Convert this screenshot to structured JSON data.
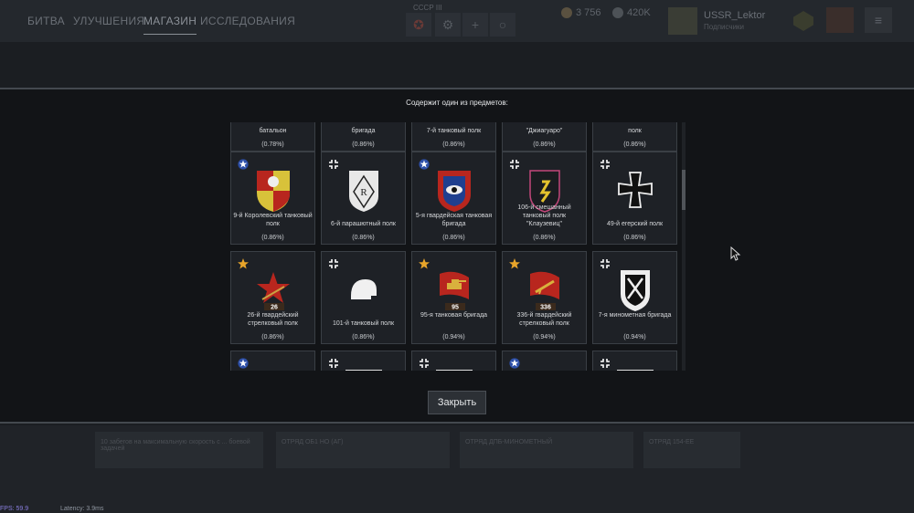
{
  "nav": {
    "tabs": [
      "БИТВА",
      "УЛУЧШЕНИЯ",
      "МАГАЗИН",
      "ИССЛЕДОВАНИЯ"
    ],
    "active_tab": "МАГАЗИН"
  },
  "header": {
    "nation_label": "СССР III",
    "gold": "3 756",
    "silver": "420K",
    "player_name": "USSR_Lektor",
    "player_status": "Подписчики"
  },
  "bottom": {
    "tasks": [
      "10 забегов на максимальную скорость с ... боевой задачей",
      "ОТРЯД ОБ1 НО (АГ)",
      "ОТРЯД ДПБ-МИНОМЕТНЫЙ",
      "ОТРЯД 154-ЕЕ"
    ],
    "fps": "FPS: 59.9",
    "latency": "Latency: 3.9ms"
  },
  "dialog": {
    "title": "Содержит один из предметов:",
    "close_label": "Закрыть"
  },
  "items": [
    {
      "name": "батальон",
      "chance": "(0.78%)",
      "mark": "usa",
      "emblem": "none"
    },
    {
      "name": "бригада",
      "chance": "(0.86%)",
      "mark": "ger",
      "emblem": "none"
    },
    {
      "name": "7-й танковый полк",
      "chance": "(0.86%)",
      "mark": "ger",
      "emblem": "none"
    },
    {
      "name": "\"Джиагуаро\"",
      "chance": "(0.86%)",
      "mark": "ger",
      "emblem": "none"
    },
    {
      "name": "полк",
      "chance": "(0.86%)",
      "mark": "ger",
      "emblem": "none"
    },
    {
      "name": "9-й Королевский танковый полк",
      "chance": "(0.86%)",
      "mark": "usa",
      "emblem": "shield-royal"
    },
    {
      "name": "6-й парашютный полк",
      "chance": "(0.86%)",
      "mark": "ger",
      "emblem": "shield-r"
    },
    {
      "name": "5-я гвардейская танковая бригада",
      "chance": "(0.86%)",
      "mark": "usa",
      "emblem": "shield-eye"
    },
    {
      "name": "106-й смешанный танковый полк \"Клаузевиц\"",
      "chance": "(0.86%)",
      "mark": "ger",
      "emblem": "shield-rune"
    },
    {
      "name": "49-й егерский полк",
      "chance": "(0.86%)",
      "mark": "ger",
      "emblem": "iron-cross"
    },
    {
      "name": "26-й гвардейский стрелковый полк",
      "chance": "(0.86%)",
      "mark": "ussr",
      "emblem": "red-star",
      "badge": "26"
    },
    {
      "name": "101-й танковый полк",
      "chance": "(0.86%)",
      "mark": "ger",
      "emblem": "helmet"
    },
    {
      "name": "95-я танковая бригада",
      "chance": "(0.94%)",
      "mark": "ussr",
      "emblem": "red-flag-tank",
      "badge": "95"
    },
    {
      "name": "336-й гвардейский стрелковый полк",
      "chance": "(0.94%)",
      "mark": "ussr",
      "emblem": "red-flag-gun",
      "badge": "336"
    },
    {
      "name": "7-я минометная бригада",
      "chance": "(0.94%)",
      "mark": "ger",
      "emblem": "shield-x"
    },
    {
      "name": "",
      "chance": "",
      "mark": "usa",
      "emblem": "partial"
    },
    {
      "name": "",
      "chance": "",
      "mark": "ger",
      "emblem": "partial"
    },
    {
      "name": "",
      "chance": "",
      "mark": "ger",
      "emblem": "partial"
    },
    {
      "name": "",
      "chance": "",
      "mark": "usa",
      "emblem": "partial"
    },
    {
      "name": "",
      "chance": "",
      "mark": "ger",
      "emblem": "partial"
    }
  ],
  "colors": {
    "ussr_star": "#e8a52a",
    "usa_star": "#2d4fa8",
    "red_emblem": "#b8261e",
    "accent_bar": "#6f747b"
  }
}
